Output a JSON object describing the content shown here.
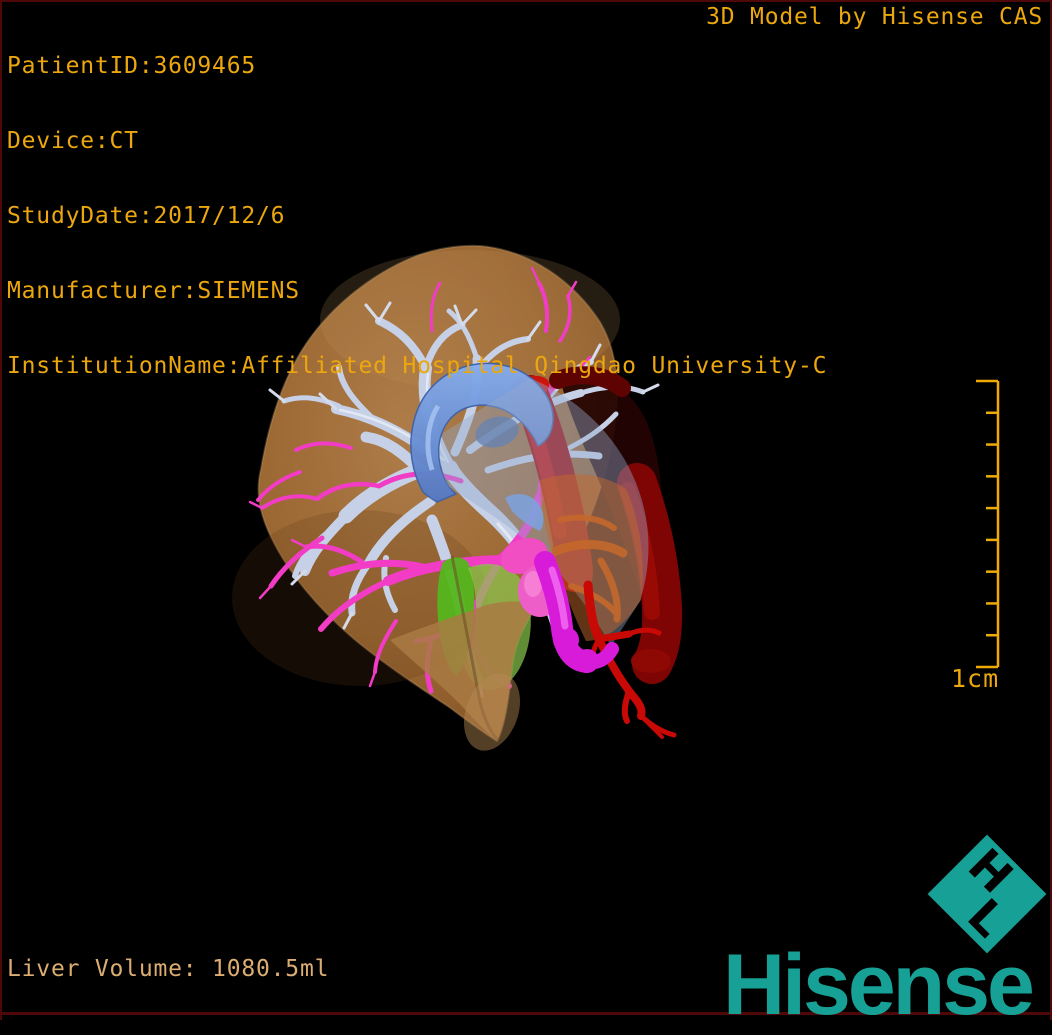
{
  "header": {
    "patient": {
      "patient_id": "PatientID:3609465",
      "device": "Device:CT",
      "study_date": "StudyDate:2017/12/6",
      "manufacturer": "Manufacturer:SIEMENS",
      "institution": "InstitutionName:Affiliated Hospital Qingdao University-C"
    },
    "title": "3D Model by Hisense CAS"
  },
  "footer": {
    "liver_volume": "Liver Volume: 1080.5ml"
  },
  "scale_bar": {
    "label": "1cm",
    "tick_count": 10
  },
  "branding": {
    "logo_letter_h": "H",
    "logo_letter_l": "L",
    "wordmark": "Hisense"
  },
  "colors": {
    "overlay_text": "#ECA70E",
    "volume_text": "#DBAD72",
    "scale": "#F0AA06",
    "brand_teal": "#17A096",
    "border": "#4E0808",
    "liver_tan": "#A6713A",
    "vein_pale_blue": "#C6D0E6",
    "vein_blue": "#6F9CE6",
    "vessel_magenta": "#F23CC6",
    "artery_red": "#A30503",
    "artery_bright_red": "#C90905",
    "tumor_green": "#54B61C",
    "duct_magenta": "#D81BD8",
    "tissue_orange": "#C4682C"
  }
}
